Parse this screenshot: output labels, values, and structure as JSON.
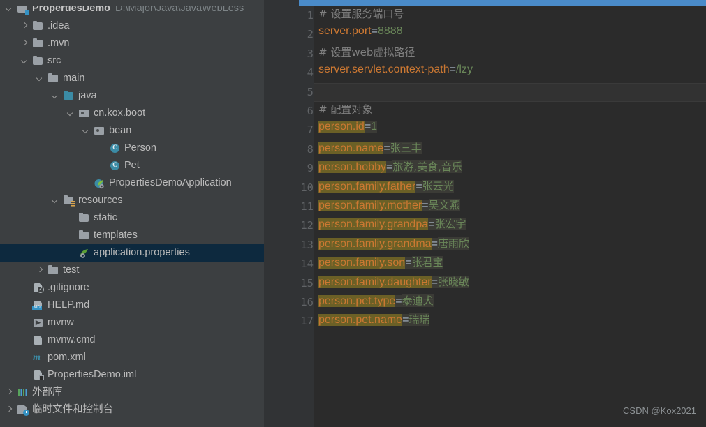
{
  "project": {
    "root": {
      "label": "PropertiesDemo",
      "path": "D:\\Major\\Java\\JavaWebLess"
    },
    "items": [
      {
        "label": ".idea",
        "indent": 1,
        "arrow": "right",
        "icon": "folder-icon"
      },
      {
        "label": ".mvn",
        "indent": 1,
        "arrow": "right",
        "icon": "folder-icon"
      },
      {
        "label": "src",
        "indent": 1,
        "arrow": "down",
        "icon": "folder-icon"
      },
      {
        "label": "main",
        "indent": 2,
        "arrow": "down",
        "icon": "folder-icon"
      },
      {
        "label": "java",
        "indent": 3,
        "arrow": "down",
        "icon": "source-root-folder-icon"
      },
      {
        "label": "cn.kox.boot",
        "indent": 4,
        "arrow": "down",
        "icon": "package-icon"
      },
      {
        "label": "bean",
        "indent": 5,
        "arrow": "down",
        "icon": "package-icon"
      },
      {
        "label": "Person",
        "indent": 6,
        "arrow": "none",
        "icon": "java-class-icon"
      },
      {
        "label": "Pet",
        "indent": 6,
        "arrow": "none",
        "icon": "java-class-icon"
      },
      {
        "label": "PropertiesDemoApplication",
        "indent": 5,
        "arrow": "none",
        "icon": "spring-boot-app-icon"
      },
      {
        "label": "resources",
        "indent": 3,
        "arrow": "down",
        "icon": "resources-root-folder-icon"
      },
      {
        "label": "static",
        "indent": 4,
        "arrow": "none",
        "icon": "folder-icon"
      },
      {
        "label": "templates",
        "indent": 4,
        "arrow": "none",
        "icon": "folder-icon"
      },
      {
        "label": "application.properties",
        "indent": 4,
        "arrow": "none",
        "icon": "spring-config-icon",
        "selected": true
      },
      {
        "label": "test",
        "indent": 2,
        "arrow": "right",
        "icon": "folder-icon"
      },
      {
        "label": ".gitignore",
        "indent": 1,
        "arrow": "none",
        "icon": "gitignore-file-icon"
      },
      {
        "label": "HELP.md",
        "indent": 1,
        "arrow": "none",
        "icon": "markdown-file-icon"
      },
      {
        "label": "mvnw",
        "indent": 1,
        "arrow": "none",
        "icon": "script-file-icon"
      },
      {
        "label": "mvnw.cmd",
        "indent": 1,
        "arrow": "none",
        "icon": "cmd-file-icon"
      },
      {
        "label": "pom.xml",
        "indent": 1,
        "arrow": "none",
        "icon": "maven-pom-icon"
      },
      {
        "label": "PropertiesDemo.iml",
        "indent": 1,
        "arrow": "none",
        "icon": "iml-file-icon"
      },
      {
        "label": "外部库",
        "indent": 0,
        "arrow": "right",
        "icon": "external-libraries-icon"
      },
      {
        "label": "临时文件和控制台",
        "indent": 0,
        "arrow": "right",
        "icon": "scratches-consoles-icon"
      }
    ]
  },
  "editor": {
    "file": "application.properties",
    "caret_line": 5,
    "lines": [
      {
        "n": "1",
        "type": "comment",
        "text": "# 设置服务端口号"
      },
      {
        "n": "2",
        "type": "prop",
        "key": "server.port",
        "eq": "=",
        "value": "8888",
        "value_kind": "number",
        "highlight": false
      },
      {
        "n": "3",
        "type": "comment",
        "text": "# 设置web虚拟路径"
      },
      {
        "n": "4",
        "type": "prop",
        "key": "server.servlet.context-path",
        "eq": "=",
        "value": "/lzy",
        "value_kind": "path",
        "highlight": false
      },
      {
        "n": "5",
        "type": "caret",
        "text": ""
      },
      {
        "n": "6",
        "type": "comment",
        "text": "# 配置对象"
      },
      {
        "n": "7",
        "type": "prop",
        "key": "person.id",
        "eq": "=",
        "value": "1",
        "value_kind": "number",
        "highlight": true
      },
      {
        "n": "8",
        "type": "prop",
        "key": "person.name",
        "eq": "=",
        "value": "张三丰",
        "value_kind": "cn",
        "highlight": true
      },
      {
        "n": "9",
        "type": "prop",
        "key": "person.hobby",
        "eq": "=",
        "value": "旅游,美食,音乐",
        "value_kind": "cn",
        "highlight": true
      },
      {
        "n": "10",
        "type": "prop",
        "key": "person.family.father",
        "eq": "=",
        "value": "张云光",
        "value_kind": "cn",
        "highlight": true
      },
      {
        "n": "11",
        "type": "prop",
        "key": "person.family.mother",
        "eq": "=",
        "value": "吴文燕",
        "value_kind": "cn",
        "highlight": true
      },
      {
        "n": "12",
        "type": "prop",
        "key": "person.family.grandpa",
        "eq": "=",
        "value": "张宏宇",
        "value_kind": "cn",
        "highlight": true
      },
      {
        "n": "13",
        "type": "prop",
        "key": "person.famliy.grandma",
        "eq": "=",
        "value": "唐雨欣",
        "value_kind": "cn",
        "highlight": true
      },
      {
        "n": "14",
        "type": "prop",
        "key": "person.family.son",
        "eq": "=",
        "value": "张君宝",
        "value_kind": "cn",
        "highlight": true
      },
      {
        "n": "15",
        "type": "prop",
        "key": "person.family.daughter",
        "eq": "=",
        "value": "张晓敏",
        "value_kind": "cn",
        "highlight": true
      },
      {
        "n": "16",
        "type": "prop",
        "key": "person.pet.type",
        "eq": "=",
        "value": "泰迪犬",
        "value_kind": "cn",
        "highlight": true
      },
      {
        "n": "17",
        "type": "prop",
        "key": "person.pet.name",
        "eq": "=",
        "value": "瑞瑞",
        "value_kind": "cn",
        "highlight": true
      }
    ]
  },
  "watermark": {
    "text": "CSDN @Kox2021"
  },
  "colors": {
    "panel_bg": "#3c3f41",
    "editor_bg": "#2b2b2b",
    "gutter_bg": "#313335",
    "selection_bg": "#0d293e",
    "scrollbar": "#4a8bc9",
    "key_fg": "#cc7832",
    "value_fg": "#6a8759",
    "comment_fg": "#808080",
    "search_highlight": "#6b6026"
  }
}
